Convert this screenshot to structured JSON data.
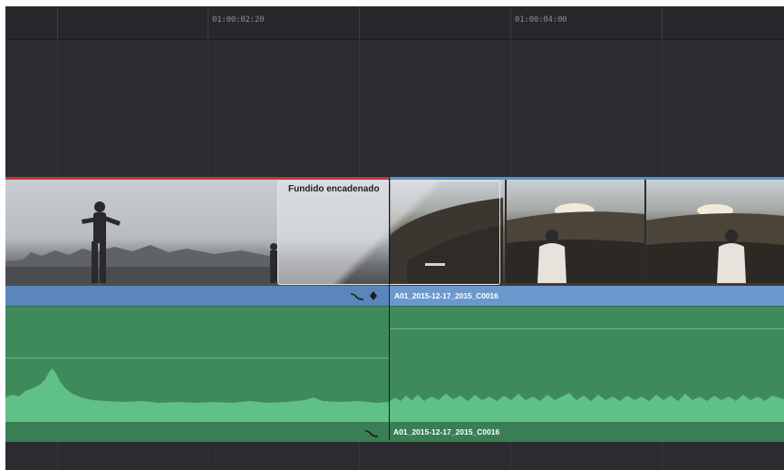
{
  "ruler": {
    "timecodes": [
      "01:00:02:20",
      "01:00:04:00"
    ]
  },
  "video": {
    "transition_label": "Fundido encadenado",
    "clip_b_name": "A01_2015-12-17_2015_C0016"
  },
  "audio": {
    "clip_name": "A01_2015-12-17_2015_C0016"
  },
  "icons": {
    "curve": "curve-icon",
    "keyframe": "keyframe-diamond-icon"
  },
  "colors": {
    "video_clip": "#5a86bb",
    "audio_clip": "#3f8a5c",
    "selected_clip_border": "#c0393b"
  }
}
